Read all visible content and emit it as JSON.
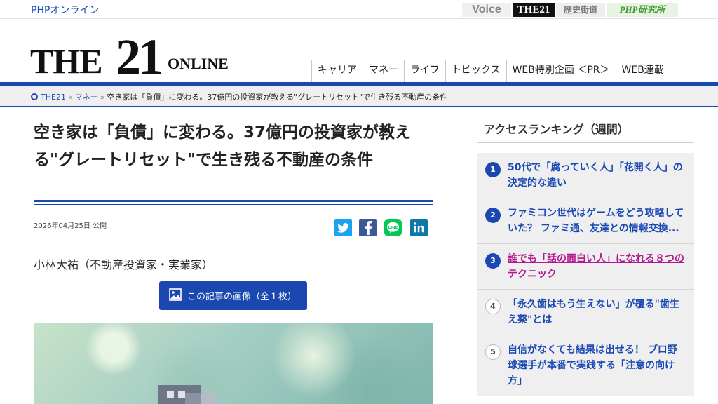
{
  "header": {
    "site_link": "PHPオンライン",
    "sister_sites": [
      "Voice",
      "THE21",
      "歴史街道",
      "PHP研究所"
    ],
    "logo": {
      "main": "THE",
      "num": "21",
      "sub": "ONLINE"
    }
  },
  "nav": [
    "キャリア",
    "マネー",
    "ライフ",
    "トピックス",
    "WEB特別企画 ＜PR＞",
    "WEB連載"
  ],
  "breadcrumb": {
    "items": [
      "THE21",
      "マネー"
    ],
    "current": "空き家は「負債」に変わる。37億円の投資家が教える\"グレートリセット\"で生き残る不動産の条件",
    "sep": "»"
  },
  "article": {
    "title": "空き家は「負債」に変わる。37億円の投資家が教える\"グレートリセット\"で生き残る不動産の条件",
    "date": "2026年04月25日 公開",
    "author": "小林大祐（不動産投資家・実業家）",
    "image_button": "この記事の画像（全１枚）",
    "share_icons": [
      "twitter-icon",
      "facebook-icon",
      "line-icon",
      "linkedin-icon"
    ],
    "share_line_label": "LINE",
    "share_colors": {
      "twitter": "#1da1f2",
      "facebook": "#3b5998",
      "line": "#06c755",
      "linkedin": "#0e76a8"
    }
  },
  "sidebar": {
    "heading": "アクセスランキング（週間）",
    "items": [
      {
        "rank": "1",
        "text": "50代で「腐っていく人」「花開く人」の決定的な違い"
      },
      {
        "rank": "2",
        "text": "ファミコン世代はゲームをどう攻略していた？ ファミ通、友達との情報交換..."
      },
      {
        "rank": "3",
        "text": "誰でも「話の面白い人」になれる８つのテクニック"
      },
      {
        "rank": "4",
        "text": "「永久歯はもう生えない」が覆る\"歯生え薬\"とは"
      },
      {
        "rank": "5",
        "text": "自信がなくても結果は出せる！ プロ野球選手が本番で実践する「注意の向け方」"
      }
    ]
  }
}
